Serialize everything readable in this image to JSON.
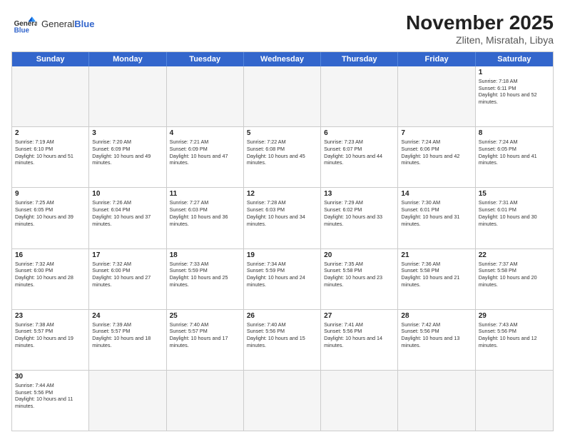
{
  "logo": {
    "line1": "General",
    "line2": "Blue"
  },
  "title": "November 2025",
  "location": "Zliten, Misratah, Libya",
  "days": [
    "Sunday",
    "Monday",
    "Tuesday",
    "Wednesday",
    "Thursday",
    "Friday",
    "Saturday"
  ],
  "rows": [
    [
      {
        "day": "",
        "empty": true
      },
      {
        "day": "",
        "empty": true
      },
      {
        "day": "",
        "empty": true
      },
      {
        "day": "",
        "empty": true
      },
      {
        "day": "",
        "empty": true
      },
      {
        "day": "",
        "empty": true
      },
      {
        "day": "1",
        "sunrise": "Sunrise: 7:18 AM",
        "sunset": "Sunset: 6:11 PM",
        "daylight": "Daylight: 10 hours and 52 minutes."
      }
    ],
    [
      {
        "day": "2",
        "sunrise": "Sunrise: 7:19 AM",
        "sunset": "Sunset: 6:10 PM",
        "daylight": "Daylight: 10 hours and 51 minutes."
      },
      {
        "day": "3",
        "sunrise": "Sunrise: 7:20 AM",
        "sunset": "Sunset: 6:09 PM",
        "daylight": "Daylight: 10 hours and 49 minutes."
      },
      {
        "day": "4",
        "sunrise": "Sunrise: 7:21 AM",
        "sunset": "Sunset: 6:09 PM",
        "daylight": "Daylight: 10 hours and 47 minutes."
      },
      {
        "day": "5",
        "sunrise": "Sunrise: 7:22 AM",
        "sunset": "Sunset: 6:08 PM",
        "daylight": "Daylight: 10 hours and 45 minutes."
      },
      {
        "day": "6",
        "sunrise": "Sunrise: 7:23 AM",
        "sunset": "Sunset: 6:07 PM",
        "daylight": "Daylight: 10 hours and 44 minutes."
      },
      {
        "day": "7",
        "sunrise": "Sunrise: 7:24 AM",
        "sunset": "Sunset: 6:06 PM",
        "daylight": "Daylight: 10 hours and 42 minutes."
      },
      {
        "day": "8",
        "sunrise": "Sunrise: 7:24 AM",
        "sunset": "Sunset: 6:05 PM",
        "daylight": "Daylight: 10 hours and 41 minutes."
      }
    ],
    [
      {
        "day": "9",
        "sunrise": "Sunrise: 7:25 AM",
        "sunset": "Sunset: 6:05 PM",
        "daylight": "Daylight: 10 hours and 39 minutes."
      },
      {
        "day": "10",
        "sunrise": "Sunrise: 7:26 AM",
        "sunset": "Sunset: 6:04 PM",
        "daylight": "Daylight: 10 hours and 37 minutes."
      },
      {
        "day": "11",
        "sunrise": "Sunrise: 7:27 AM",
        "sunset": "Sunset: 6:03 PM",
        "daylight": "Daylight: 10 hours and 36 minutes."
      },
      {
        "day": "12",
        "sunrise": "Sunrise: 7:28 AM",
        "sunset": "Sunset: 6:03 PM",
        "daylight": "Daylight: 10 hours and 34 minutes."
      },
      {
        "day": "13",
        "sunrise": "Sunrise: 7:29 AM",
        "sunset": "Sunset: 6:02 PM",
        "daylight": "Daylight: 10 hours and 33 minutes."
      },
      {
        "day": "14",
        "sunrise": "Sunrise: 7:30 AM",
        "sunset": "Sunset: 6:01 PM",
        "daylight": "Daylight: 10 hours and 31 minutes."
      },
      {
        "day": "15",
        "sunrise": "Sunrise: 7:31 AM",
        "sunset": "Sunset: 6:01 PM",
        "daylight": "Daylight: 10 hours and 30 minutes."
      }
    ],
    [
      {
        "day": "16",
        "sunrise": "Sunrise: 7:32 AM",
        "sunset": "Sunset: 6:00 PM",
        "daylight": "Daylight: 10 hours and 28 minutes."
      },
      {
        "day": "17",
        "sunrise": "Sunrise: 7:32 AM",
        "sunset": "Sunset: 6:00 PM",
        "daylight": "Daylight: 10 hours and 27 minutes."
      },
      {
        "day": "18",
        "sunrise": "Sunrise: 7:33 AM",
        "sunset": "Sunset: 5:59 PM",
        "daylight": "Daylight: 10 hours and 25 minutes."
      },
      {
        "day": "19",
        "sunrise": "Sunrise: 7:34 AM",
        "sunset": "Sunset: 5:59 PM",
        "daylight": "Daylight: 10 hours and 24 minutes."
      },
      {
        "day": "20",
        "sunrise": "Sunrise: 7:35 AM",
        "sunset": "Sunset: 5:58 PM",
        "daylight": "Daylight: 10 hours and 23 minutes."
      },
      {
        "day": "21",
        "sunrise": "Sunrise: 7:36 AM",
        "sunset": "Sunset: 5:58 PM",
        "daylight": "Daylight: 10 hours and 21 minutes."
      },
      {
        "day": "22",
        "sunrise": "Sunrise: 7:37 AM",
        "sunset": "Sunset: 5:58 PM",
        "daylight": "Daylight: 10 hours and 20 minutes."
      }
    ],
    [
      {
        "day": "23",
        "sunrise": "Sunrise: 7:38 AM",
        "sunset": "Sunset: 5:57 PM",
        "daylight": "Daylight: 10 hours and 19 minutes."
      },
      {
        "day": "24",
        "sunrise": "Sunrise: 7:39 AM",
        "sunset": "Sunset: 5:57 PM",
        "daylight": "Daylight: 10 hours and 18 minutes."
      },
      {
        "day": "25",
        "sunrise": "Sunrise: 7:40 AM",
        "sunset": "Sunset: 5:57 PM",
        "daylight": "Daylight: 10 hours and 17 minutes."
      },
      {
        "day": "26",
        "sunrise": "Sunrise: 7:40 AM",
        "sunset": "Sunset: 5:56 PM",
        "daylight": "Daylight: 10 hours and 15 minutes."
      },
      {
        "day": "27",
        "sunrise": "Sunrise: 7:41 AM",
        "sunset": "Sunset: 5:56 PM",
        "daylight": "Daylight: 10 hours and 14 minutes."
      },
      {
        "day": "28",
        "sunrise": "Sunrise: 7:42 AM",
        "sunset": "Sunset: 5:56 PM",
        "daylight": "Daylight: 10 hours and 13 minutes."
      },
      {
        "day": "29",
        "sunrise": "Sunrise: 7:43 AM",
        "sunset": "Sunset: 5:56 PM",
        "daylight": "Daylight: 10 hours and 12 minutes."
      }
    ],
    [
      {
        "day": "30",
        "sunrise": "Sunrise: 7:44 AM",
        "sunset": "Sunset: 5:56 PM",
        "daylight": "Daylight: 10 hours and 11 minutes."
      },
      {
        "day": "",
        "empty": true
      },
      {
        "day": "",
        "empty": true
      },
      {
        "day": "",
        "empty": true
      },
      {
        "day": "",
        "empty": true
      },
      {
        "day": "",
        "empty": true
      },
      {
        "day": "",
        "empty": true
      }
    ]
  ]
}
